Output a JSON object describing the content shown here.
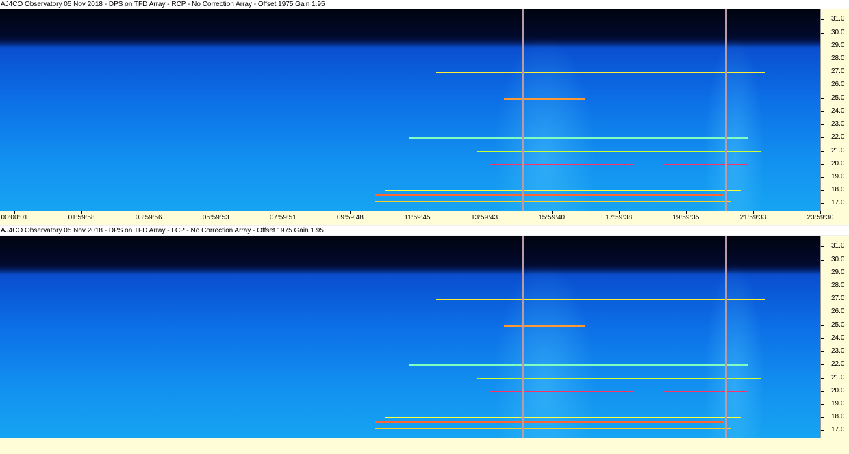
{
  "panels": [
    {
      "title": "AJ4CO Observatory 05 Nov 2018  -  DPS on TFD Array  -  RCP  -  No Correction Array  -  Offset 1975  Gain 1.95",
      "time_labels": [
        "00:00:01",
        "01:59:58",
        "03:59:56",
        "05:59:53",
        "07:59:51",
        "09:59:48",
        "11:59:45",
        "13:59:43",
        "15:59:40",
        "17:59:38",
        "19:59:35",
        "21:59:33",
        "23:59:30"
      ]
    },
    {
      "title": "AJ4CO Observatory 05 Nov 2018  -  DPS on TFD Array  -  LCP  -  No Correction Array  -  Offset 1975  Gain 1.95",
      "time_labels": []
    }
  ],
  "chart_data": {
    "type": "heatmap",
    "freq_ticks": [
      "31.0",
      "30.0",
      "29.0",
      "28.0",
      "27.0",
      "26.0",
      "25.0",
      "24.0",
      "23.0",
      "22.0",
      "21.0",
      "20.0",
      "19.0",
      "18.0",
      "17.0"
    ],
    "freq_range": [
      16.4,
      31.8
    ],
    "time_range_hours": [
      0.0003,
      23.9917
    ],
    "marker_times_hours": [
      15.33,
      21.33
    ],
    "activity_windows_hours": [
      [
        14.5,
        17.5
      ],
      [
        20.7,
        22.5
      ]
    ],
    "emission_lines": [
      {
        "freq": 27.0,
        "t0": 12.8,
        "t1": 22.5,
        "color": "#ffee33"
      },
      {
        "freq": 25.0,
        "t0": 14.8,
        "t1": 17.2,
        "color": "#ff9933"
      },
      {
        "freq": 22.0,
        "t0": 12.0,
        "t1": 22.0,
        "color": "#7fffc0"
      },
      {
        "freq": 21.0,
        "t0": 14.0,
        "t1": 22.4,
        "color": "#ccff33"
      },
      {
        "freq": 20.0,
        "t0": 14.4,
        "t1": 18.6,
        "color": "#ff3366"
      },
      {
        "freq": 20.0,
        "t0": 19.5,
        "t1": 22.0,
        "color": "#ff3366"
      },
      {
        "freq": 18.0,
        "t0": 11.3,
        "t1": 21.8,
        "color": "#ffff40"
      },
      {
        "freq": 17.7,
        "t0": 11.0,
        "t1": 21.3,
        "color": "#ff6633"
      },
      {
        "freq": 17.2,
        "t0": 11.0,
        "t1": 21.5,
        "color": "#ffcc22"
      }
    ]
  }
}
